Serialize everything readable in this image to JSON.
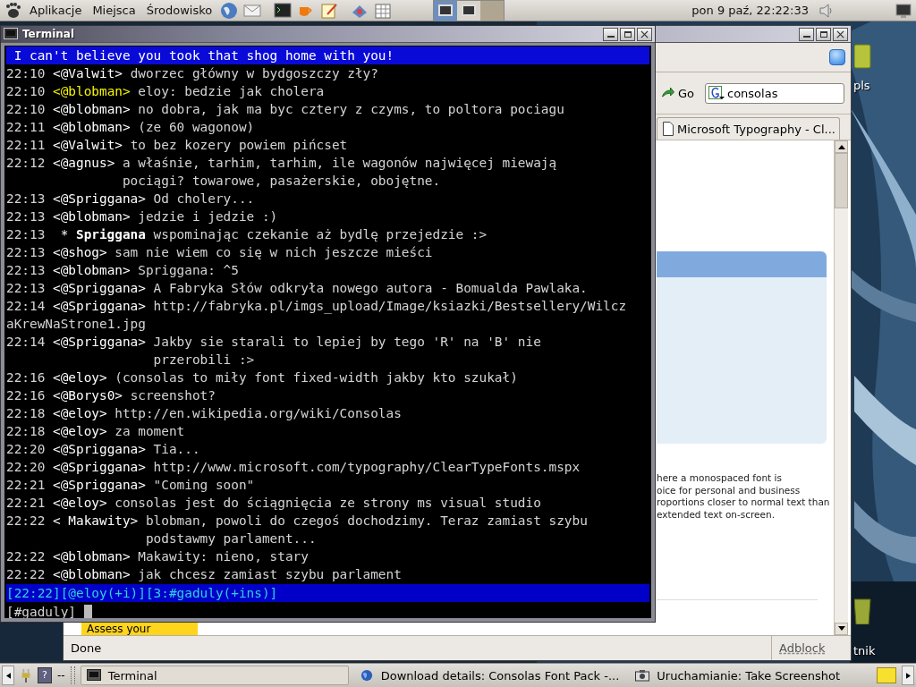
{
  "top_panel": {
    "menus": [
      "Aplikacje",
      "Miejsca",
      "Środowisko"
    ],
    "clock": "pon  9 paź, 22:22:33"
  },
  "desktop": {
    "icons": [
      {
        "label": "pls",
        "kind": "folder"
      },
      {
        "label": "tnik",
        "kind": "trash"
      }
    ]
  },
  "browser": {
    "go_button": "Go",
    "search": {
      "value": "consolas"
    },
    "tab": "Microsoft Typography - Cl...",
    "paragraph": [
      "here a monospaced font is",
      "oice for personal and business",
      "roportions closer to normal text than",
      "extended text on-screen."
    ],
    "promo_button": "Assess your",
    "status": "Done",
    "status_addon": "Adblock"
  },
  "terminal": {
    "title": "Terminal",
    "topic": " I can't believe you took that shog home with you!",
    "lines": [
      {
        "kind": "message",
        "time": "22:10",
        "nick": "<@Valwit>",
        "highlight": false,
        "text": [
          "dworzec główny w bydgoszczy zły?"
        ]
      },
      {
        "kind": "message",
        "time": "22:10",
        "nick": "<@blobman>",
        "highlight": true,
        "text": [
          "eloy: bedzie jak cholera"
        ]
      },
      {
        "kind": "message",
        "time": "22:10",
        "nick": "<@blobman>",
        "highlight": false,
        "text": [
          "no dobra, jak ma byc cztery z czyms, to poltora pociagu"
        ]
      },
      {
        "kind": "message",
        "time": "22:11",
        "nick": "<@blobman>",
        "highlight": false,
        "text": [
          "(ze 60 wagonow)"
        ]
      },
      {
        "kind": "message",
        "time": "22:11",
        "nick": "<@Valwit>",
        "highlight": false,
        "text": [
          "to bez kozery powiem pińcset"
        ]
      },
      {
        "kind": "message",
        "time": "22:12",
        "nick": "<@agnus>",
        "highlight": false,
        "text": [
          "a właśnie, tarhim, tarhim, ile wagonów najwięcej miewają",
          "pociągi? towarowe, pasażerskie, obojętne."
        ]
      },
      {
        "kind": "message",
        "time": "22:13",
        "nick": "<@Spriggana>",
        "highlight": false,
        "text": [
          "Od cholery..."
        ]
      },
      {
        "kind": "message",
        "time": "22:13",
        "nick": "<@blobman>",
        "highlight": false,
        "text": [
          "jedzie i jedzie :)"
        ]
      },
      {
        "kind": "action",
        "time": "22:13",
        "marker": "*",
        "nick": "Spriggana",
        "text": [
          "wspominając czekanie aż bydlę przejedzie :>"
        ]
      },
      {
        "kind": "message",
        "time": "22:13",
        "nick": "<@shog>",
        "highlight": false,
        "text": [
          "sam nie wiem co się w nich jeszcze mieści"
        ]
      },
      {
        "kind": "message",
        "time": "22:13",
        "nick": "<@blobman>",
        "highlight": false,
        "text": [
          "Spriggana: ^5"
        ]
      },
      {
        "kind": "message",
        "time": "22:13",
        "nick": "<@Spriggana>",
        "highlight": false,
        "text": [
          "A Fabryka Słów odkryła nowego autora - Bomualda Pawlaka."
        ]
      },
      {
        "kind": "message",
        "time": "22:14",
        "nick": "<@Spriggana>",
        "highlight": false,
        "text": [
          "http://fabryka.pl/imgs_upload/Image/ksiazki/Bestsellery/Wilcz"
        ]
      },
      {
        "kind": "continuation",
        "text": [
          "aKrewNaStrone1.jpg"
        ]
      },
      {
        "kind": "message",
        "time": "22:14",
        "nick": "<@Spriggana>",
        "highlight": false,
        "text": [
          "Jakby sie starali to lepiej by tego 'R' na 'B' nie",
          "przerobili :>"
        ]
      },
      {
        "kind": "message",
        "time": "22:16",
        "nick": "<@eloy>",
        "highlight": false,
        "text": [
          "(consolas to miły font fixed-width jakby kto szukał)"
        ]
      },
      {
        "kind": "message",
        "time": "22:16",
        "nick": "<@Borys0>",
        "highlight": false,
        "text": [
          "screenshot?"
        ]
      },
      {
        "kind": "message",
        "time": "22:18",
        "nick": "<@eloy>",
        "highlight": false,
        "text": [
          "http://en.wikipedia.org/wiki/Consolas"
        ]
      },
      {
        "kind": "message",
        "time": "22:18",
        "nick": "<@eloy>",
        "highlight": false,
        "text": [
          "za moment"
        ]
      },
      {
        "kind": "message",
        "time": "22:20",
        "nick": "<@Spriggana>",
        "highlight": false,
        "text": [
          "Tia..."
        ]
      },
      {
        "kind": "message",
        "time": "22:20",
        "nick": "<@Spriggana>",
        "highlight": false,
        "text": [
          "http://www.microsoft.com/typography/ClearTypeFonts.mspx"
        ]
      },
      {
        "kind": "message",
        "time": "22:21",
        "nick": "<@Spriggana>",
        "highlight": false,
        "text": [
          "\"Coming soon\""
        ]
      },
      {
        "kind": "message",
        "time": "22:21",
        "nick": "<@eloy>",
        "highlight": false,
        "text": [
          "consolas jest do ściągnięcia ze strony ms visual studio"
        ]
      },
      {
        "kind": "message",
        "time": "22:22",
        "nick": "< Makawity>",
        "highlight": false,
        "text": [
          "blobman, powoli do czegoś dochodzimy. Teraz zamiast szybu",
          "podstawmy parlament..."
        ]
      },
      {
        "kind": "message",
        "time": "22:22",
        "nick": "<@blobman>",
        "highlight": false,
        "text": [
          "Makawity: nieno, stary"
        ]
      },
      {
        "kind": "message",
        "time": "22:22",
        "nick": "<@blobman>",
        "highlight": false,
        "text": [
          "jak chcesz zamiast szybu parlament"
        ]
      }
    ],
    "statusbar": "[22:22][@eloy(+i)][3:#gaduly(+ins)]",
    "prompt": "[#gaduly]"
  },
  "taskbar": {
    "help_glyph": "?",
    "pager": "--",
    "tasks": [
      {
        "label": "Terminal",
        "kind": "terminal",
        "selected": true
      },
      {
        "label": "Download details: Consolas Font Pack -...",
        "kind": "globe",
        "selected": false
      },
      {
        "label": "Uruchamianie: Take Screenshot",
        "kind": "camera",
        "selected": false
      }
    ]
  }
}
